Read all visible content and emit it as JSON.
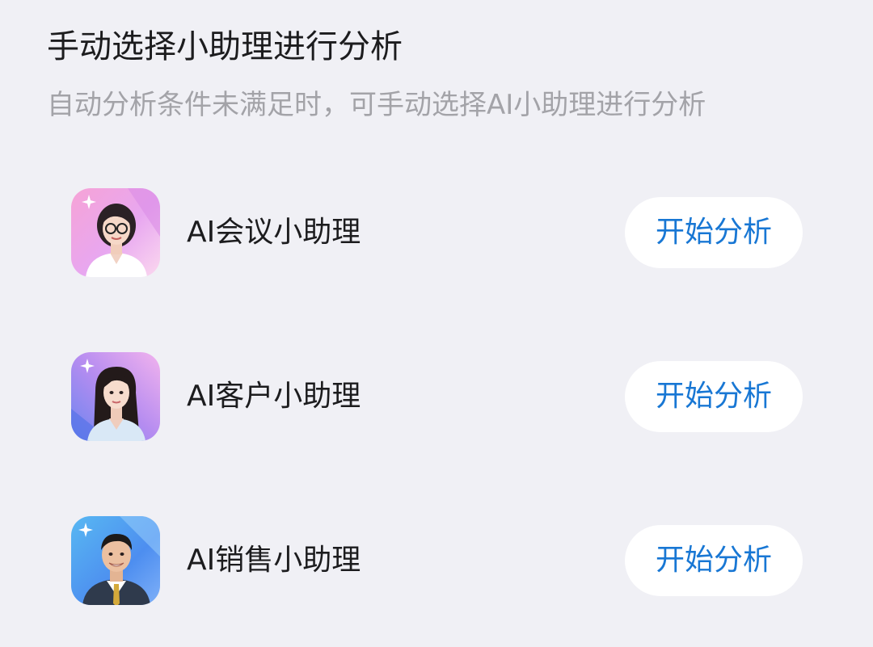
{
  "header": {
    "title": "手动选择小助理进行分析",
    "subtitle": "自动分析条件未满足时，可手动选择AI小助理进行分析"
  },
  "assistants": [
    {
      "name": "AI会议小助理",
      "button_label": "开始分析",
      "avatar_icon": "meeting-assistant-avatar"
    },
    {
      "name": "AI客户小助理",
      "button_label": "开始分析",
      "avatar_icon": "customer-assistant-avatar"
    },
    {
      "name": "AI销售小助理",
      "button_label": "开始分析",
      "avatar_icon": "sales-assistant-avatar"
    }
  ],
  "colors": {
    "background": "#f0f0f5",
    "accent": "#1877d4",
    "button_bg": "#ffffff",
    "subtitle": "#a3a3a8"
  }
}
